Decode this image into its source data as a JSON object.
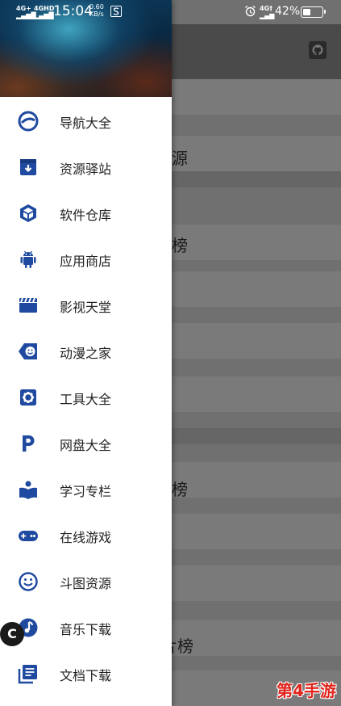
{
  "status_bar": {
    "sig1": "4G+",
    "sig2": "4GHD",
    "time": "15:04",
    "speed_value": "0.60",
    "speed_unit": "KB/s",
    "sig3": "4G†",
    "battery_percent": "42%"
  },
  "background": {
    "fragments": [
      "源",
      "榜",
      "榜",
      "片榜"
    ]
  },
  "drawer": {
    "items": [
      {
        "label": "导航大全",
        "icon": "compass-icon"
      },
      {
        "label": "资源驿站",
        "icon": "archive-icon"
      },
      {
        "label": "软件仓库",
        "icon": "cube-icon"
      },
      {
        "label": "应用商店",
        "icon": "android-icon"
      },
      {
        "label": "影视天堂",
        "icon": "clapperboard-icon"
      },
      {
        "label": "动漫之家",
        "icon": "smile-tag-icon"
      },
      {
        "label": "工具大全",
        "icon": "gear-icon"
      },
      {
        "label": "网盘大全",
        "icon": "p-icon"
      },
      {
        "label": "学习专栏",
        "icon": "book-reader-icon"
      },
      {
        "label": "在线游戏",
        "icon": "gamepad-icon"
      },
      {
        "label": "斗图资源",
        "icon": "smiley-icon"
      },
      {
        "label": "音乐下载",
        "icon": "music-icon"
      },
      {
        "label": "文档下载",
        "icon": "document-icon"
      }
    ]
  },
  "badge": "C",
  "watermark": "第4手游",
  "colors": {
    "accent": "#1f4aa0",
    "drawer_bg": "#ffffff",
    "text": "#222222"
  }
}
